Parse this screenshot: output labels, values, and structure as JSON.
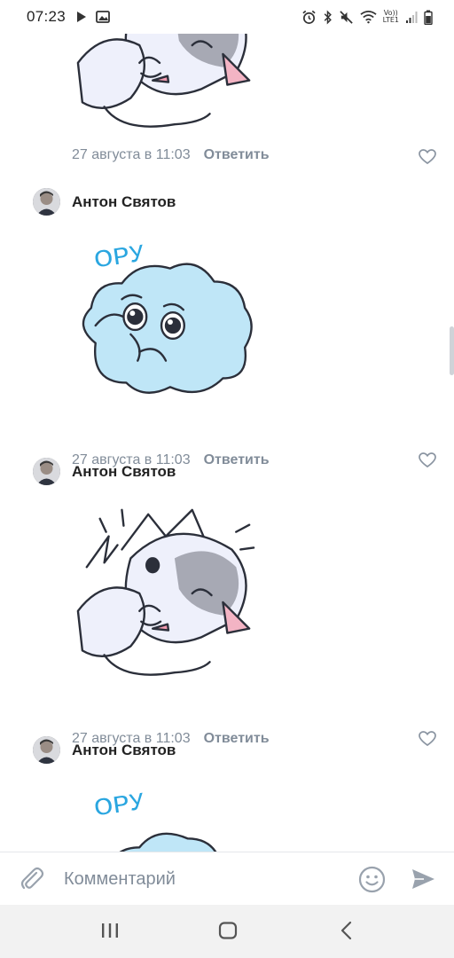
{
  "status_bar": {
    "time": "07:23",
    "left_icons": [
      "play-icon",
      "image-icon"
    ],
    "right_icons": [
      "alarm-icon",
      "bluetooth-icon",
      "mute-icon",
      "wifi-icon",
      "volte-icon",
      "signal-icon",
      "battery-icon"
    ],
    "volte_label_top": "Vo))",
    "volte_label_bottom": "LTE1"
  },
  "comments": [
    {
      "author": "",
      "sticker": "cat-facepalm-sticker",
      "date": "27 августа в 11:03",
      "reply_label": "Ответить"
    },
    {
      "author": "Антон Святов",
      "sticker": "cloud-ory-sticker",
      "sticker_text": "ОРУ",
      "date": "27 августа в 11:03",
      "reply_label": "Ответить"
    },
    {
      "author": "Антон Святов",
      "sticker": "cat-facepalm-sticker",
      "date": "27 августа в 11:03",
      "reply_label": "Ответить"
    },
    {
      "author": "Антон Святов",
      "sticker": "cloud-ory-sticker",
      "sticker_text": "ОРУ"
    }
  ],
  "composer": {
    "placeholder": "Комментарий",
    "value": ""
  },
  "nav_bar": {
    "buttons": [
      "recent-apps",
      "home",
      "back"
    ]
  },
  "colors": {
    "accent": "#818c99",
    "text": "#222222",
    "sticker_blue": "#bfe6f7",
    "sticker_text_blue": "#2aa6e0",
    "nav_bg": "#f2f2f2"
  }
}
